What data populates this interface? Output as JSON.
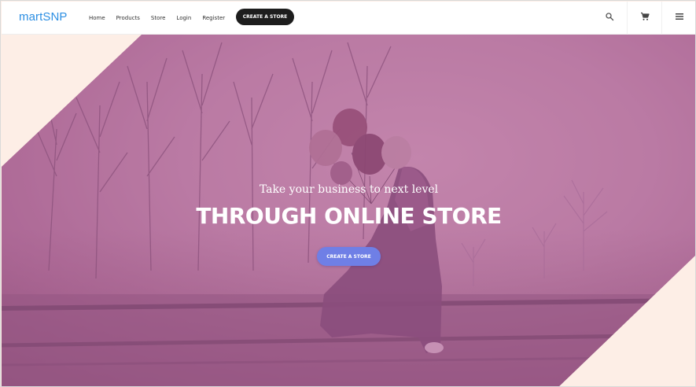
{
  "navbar": {
    "brand": "martSNP",
    "links": [
      {
        "label": "Home"
      },
      {
        "label": "Products"
      },
      {
        "label": "Store"
      },
      {
        "label": "Login"
      },
      {
        "label": "Register"
      }
    ],
    "cta_label": "CREATE A STORE",
    "icons": [
      "search-icon",
      "cart-icon",
      "menu-icon"
    ]
  },
  "hero": {
    "subtitle": "Take your business to next level",
    "title": "THROUGH ONLINE STORE",
    "cta_label": "CREATE A STORE"
  },
  "colors": {
    "brand": "#2d8fe3",
    "nav_cta_bg": "#1d1d1d",
    "hero_overlay": "#b77aa1",
    "hero_cta_bg": "#6f7fe6",
    "corner_bg": "#fdeee6"
  }
}
